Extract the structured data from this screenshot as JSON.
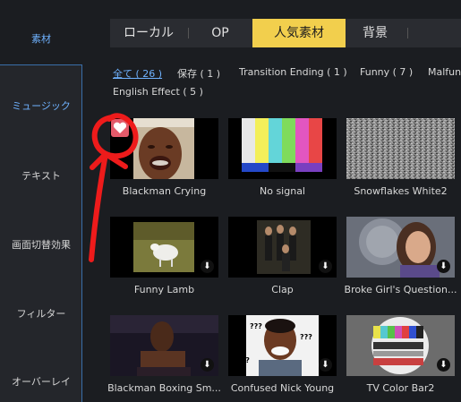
{
  "sidebar": {
    "items": [
      {
        "label": "素材"
      },
      {
        "label": "ミュージック"
      },
      {
        "label": "テキスト"
      },
      {
        "label": "画面切替効果"
      },
      {
        "label": "フィルター"
      },
      {
        "label": "オーバーレイ"
      }
    ]
  },
  "tabs": [
    {
      "label": "ローカル"
    },
    {
      "label": "OP"
    },
    {
      "label": "人気素材"
    },
    {
      "label": "背景"
    }
  ],
  "filters": [
    {
      "label": "全て ( 26 )"
    },
    {
      "label": "保存 ( 1 )"
    },
    {
      "label": "Transition Ending ( 1 )"
    },
    {
      "label": "Funny ( 7 )"
    },
    {
      "label": "Malfun"
    },
    {
      "label": "English Effect ( 5 )"
    }
  ],
  "items": [
    {
      "title": "Blackman Crying"
    },
    {
      "title": "No signal"
    },
    {
      "title": "Snowflakes White2"
    },
    {
      "title": "Funny Lamb"
    },
    {
      "title": "Clap"
    },
    {
      "title": "Broke Girl's Question..."
    },
    {
      "title": "Blackman Boxing Sm..."
    },
    {
      "title": "Confused Nick Young"
    },
    {
      "title": "TV Color Bar2"
    }
  ],
  "overlay_text": {
    "question_marks": "???"
  },
  "colors": {
    "accent": "#f2cf4d",
    "active_blue": "#6fb2ff",
    "annotation_red": "#ee1b1b"
  }
}
